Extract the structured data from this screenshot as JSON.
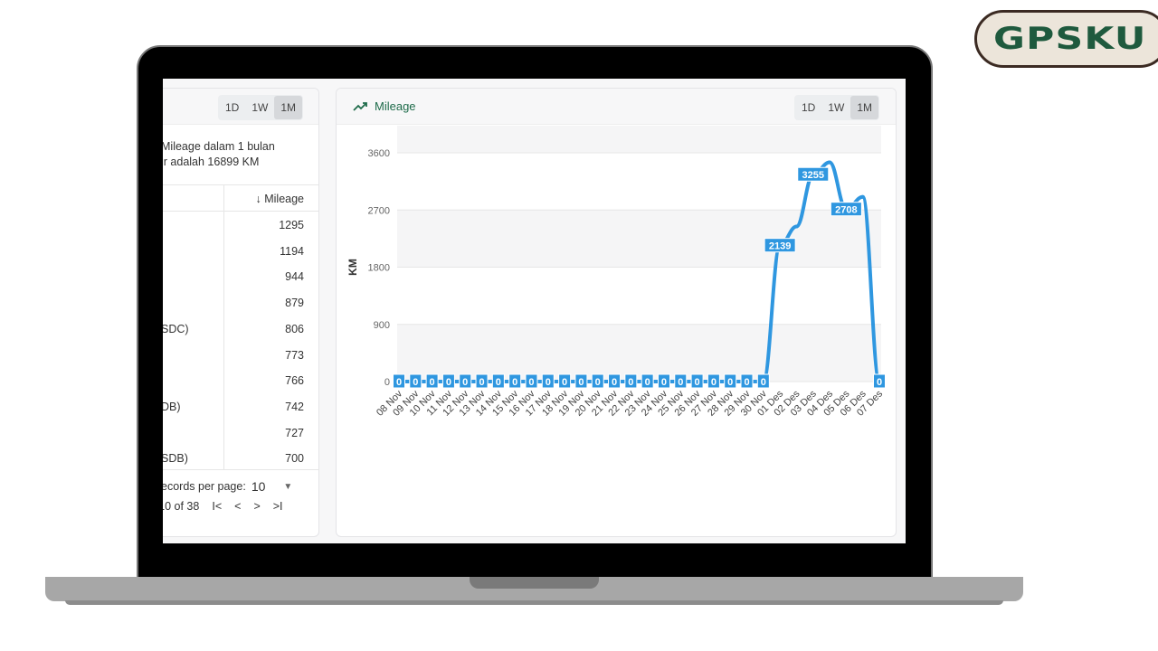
{
  "logo": {
    "text": "GPSKU"
  },
  "left_panel": {
    "ranges": [
      "1D",
      "1W",
      "1M"
    ],
    "active_range": "1M",
    "summary_line1": "Mileage dalam 1 bulan",
    "summary_line2": "ir adalah 16899 KM",
    "column_header": "↓ Mileage",
    "rows": [
      {
        "name": "",
        "mileage": "1295"
      },
      {
        "name": "",
        "mileage": "1194"
      },
      {
        "name": "",
        "mileage": "944"
      },
      {
        "name": "",
        "mileage": "879"
      },
      {
        "name": "SDC)",
        "mileage": "806"
      },
      {
        "name": "",
        "mileage": "773"
      },
      {
        "name": "",
        "mileage": "766"
      },
      {
        "name": "DB)",
        "mileage": "742"
      },
      {
        "name": "",
        "mileage": "727"
      },
      {
        "name": "SDB)",
        "mileage": "700"
      }
    ],
    "records_label": "ecords per page:",
    "records_value": "10",
    "range_text": "-10 of 38"
  },
  "right_panel": {
    "title": "Mileage",
    "ranges": [
      "1D",
      "1W",
      "1M"
    ],
    "active_range": "1M"
  },
  "chart_data": {
    "type": "line",
    "ylabel": "KM",
    "ylim": [
      0,
      3600
    ],
    "yticks": [
      0,
      900,
      1800,
      2700,
      3600
    ],
    "grid": true,
    "line_color": "#2f97e0",
    "categories": [
      "08 Nov",
      "09 Nov",
      "10 Nov",
      "11 Nov",
      "12 Nov",
      "13 Nov",
      "14 Nov",
      "15 Nov",
      "16 Nov",
      "17 Nov",
      "18 Nov",
      "19 Nov",
      "20 Nov",
      "21 Nov",
      "22 Nov",
      "23 Nov",
      "24 Nov",
      "25 Nov",
      "26 Nov",
      "27 Nov",
      "28 Nov",
      "29 Nov",
      "30 Nov",
      "01 Des",
      "02 Des",
      "03 Des",
      "04 Des",
      "05 Des",
      "06 Des",
      "07 Des"
    ],
    "values": [
      0,
      0,
      0,
      0,
      0,
      0,
      0,
      0,
      0,
      0,
      0,
      0,
      0,
      0,
      0,
      0,
      0,
      0,
      0,
      0,
      0,
      0,
      0,
      2139,
      2440,
      3255,
      3450,
      2708,
      2907,
      0
    ],
    "data_labels": [
      "0",
      "0",
      "0",
      "0",
      "0",
      "0",
      "0",
      "0",
      "0",
      "0",
      "0",
      "0",
      "0",
      "0",
      "0",
      "0",
      "0",
      "0",
      "0",
      "0",
      "0",
      "0",
      "0",
      "2139",
      null,
      "3255",
      null,
      "2708",
      null,
      "0"
    ]
  }
}
